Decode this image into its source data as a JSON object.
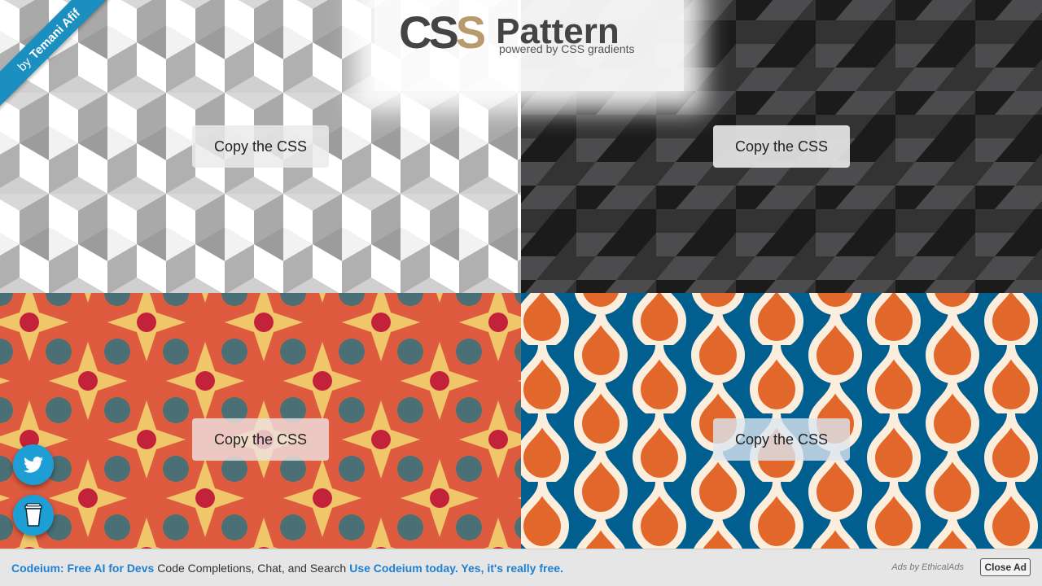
{
  "logo": {
    "css_left": "CS",
    "css_right": "S",
    "word": "Pattern",
    "tagline": "powered by CSS gradients"
  },
  "author_ribbon": {
    "prefix": "by",
    "name": "Temani Afif"
  },
  "patterns": [
    {
      "button": "Copy the CSS",
      "colors": [
        "#ffffff",
        "#d6d6d6",
        "#a9a9a9"
      ]
    },
    {
      "button": "Copy the CSS",
      "colors": [
        "#1b1b1b",
        "#333333",
        "#4c4c4e"
      ]
    },
    {
      "button": "Copy the CSS",
      "colors": [
        "#de5b40",
        "#f0cc6c",
        "#c4223b",
        "#4a7076"
      ]
    },
    {
      "button": "Copy the CSS",
      "colors": [
        "#e2672a",
        "#005f8f",
        "#fbeedd"
      ]
    }
  ],
  "social": {
    "twitter_icon": "twitter-icon",
    "coffee_icon": "coffee-cup-icon"
  },
  "ad": {
    "brand": "Codeium: Free AI for Devs",
    "text": "Code Completions, Chat, and Search",
    "cta": "Use Codeium today. Yes, it's really free.",
    "by": "Ads by EthicalAds",
    "close": "Close Ad"
  }
}
